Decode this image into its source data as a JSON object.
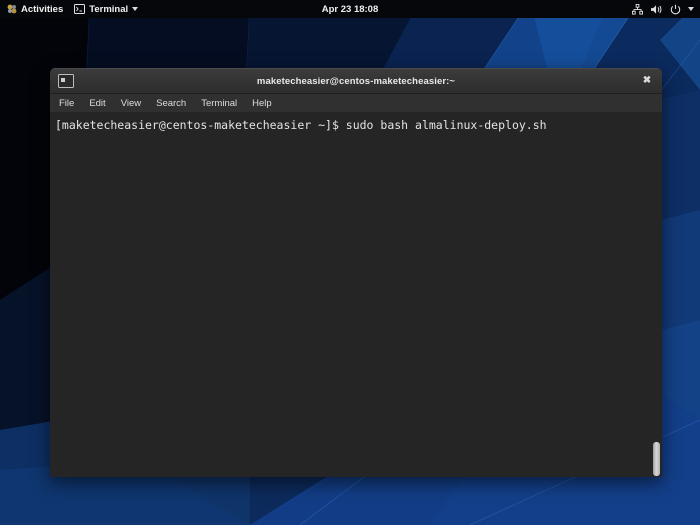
{
  "topbar": {
    "activities_label": "Activities",
    "activities_icon": "gnome-footprints-icon",
    "app_menu_label": "Terminal",
    "app_menu_icon": "terminal-icon",
    "app_menu_arrow_icon": "chevron-down-icon",
    "clock": "Apr 23  18:08",
    "status_icons": [
      {
        "name": "network-icon",
        "label": "Network"
      },
      {
        "name": "volume-icon",
        "label": "Volume"
      },
      {
        "name": "power-icon",
        "label": "Power"
      },
      {
        "name": "chevron-down-icon",
        "label": "System menu"
      }
    ],
    "background_color": "#05070a",
    "text_color": "#f1f1f1"
  },
  "window": {
    "title": "maketecheasier@centos-maketecheasier:~",
    "icon_name": "terminal-window-icon",
    "close_label": "✖",
    "titlebar_color": "#333333",
    "body_color": "#252525"
  },
  "menubar": {
    "items": [
      {
        "label": "File"
      },
      {
        "label": "Edit"
      },
      {
        "label": "View"
      },
      {
        "label": "Search"
      },
      {
        "label": "Terminal"
      },
      {
        "label": "Help"
      }
    ]
  },
  "terminal": {
    "prompt": "[maketecheasier@centos-maketecheasier ~]$ ",
    "command": "sudo bash almalinux-deploy.sh",
    "full_line": "[maketecheasier@centos-maketecheasier ~]$ sudo bash almalinux-deploy.sh",
    "foreground_color": "#e4e4e4"
  },
  "scrollbar": {
    "name": "terminal-scrollbar",
    "position": "bottom"
  },
  "desktop": {
    "wallpaper_name": "centos-blue-faceted-wallpaper",
    "base_color": "#0b2552",
    "accent_color": "#14407f"
  }
}
